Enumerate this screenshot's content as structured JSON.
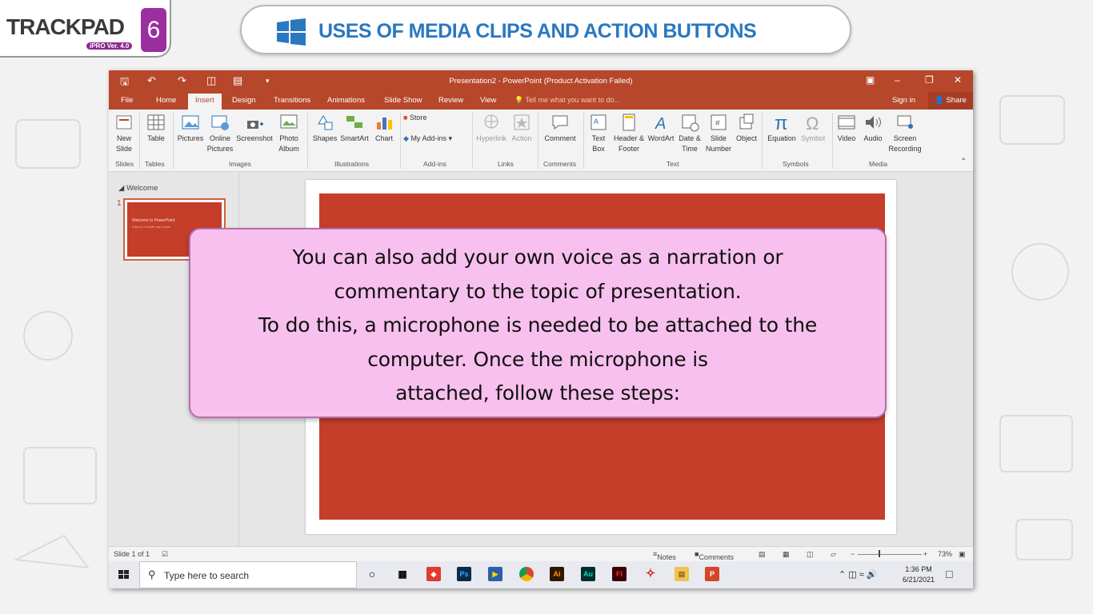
{
  "logo": {
    "text": "TRACKPAD",
    "sub": "iPRO Ver. 4.0",
    "badge": "6"
  },
  "banner": {
    "title": "USES OF MEDIA CLIPS AND ACTION BUTTONS"
  },
  "ppt": {
    "window_title": "Presentation2 - PowerPoint (Product Activation Failed)",
    "tabs": [
      "File",
      "Home",
      "Insert",
      "Design",
      "Transitions",
      "Animations",
      "Slide Show",
      "Review",
      "View"
    ],
    "active_tab": "Insert",
    "tell_me": "Tell me what you want to do...",
    "sign_in": "Sign in",
    "share": "Share",
    "ribbon": {
      "new_slide": "New Slide",
      "table": "Table",
      "pictures": "Pictures",
      "online_pictures": "Online Pictures",
      "screenshot": "Screenshot",
      "photo_album": "Photo Album",
      "shapes": "Shapes",
      "smartart": "SmartArt",
      "chart": "Chart",
      "store": "Store",
      "my_addins": "My Add-ins",
      "hyperlink": "Hyperlink",
      "action": "Action",
      "comment": "Comment",
      "text_box": "Text Box",
      "header_footer": "Header & Footer",
      "wordart": "WordArt",
      "date_time": "Date & Time",
      "slide_number": "Slide Number",
      "object": "Object",
      "equation": "Equation",
      "symbol": "Symbol",
      "video": "Video",
      "audio": "Audio",
      "screen_recording": "Screen Recording",
      "groups": [
        "Slides",
        "Tables",
        "Images",
        "Illustrations",
        "Add-ins",
        "Links",
        "Comments",
        "Text",
        "Symbols",
        "Media"
      ]
    },
    "thumbs": {
      "section": "Welcome",
      "slide_number": "1",
      "slide_title": "Welcome to PowerPoint",
      "slide_subtitle": "5 tips for a simpler way to work"
    },
    "status": {
      "slide_info": "Slide 1 of 1",
      "notes": "Notes",
      "comments": "Comments",
      "zoom": "73%"
    },
    "taskbar": {
      "search_placeholder": "Type here to search",
      "time": "1:36 PM",
      "date": "6/21/2021"
    }
  },
  "callout": {
    "lines": [
      "You can also add your own voice as a narration or",
      "commentary to the topic of presentation.",
      "To do this, a microphone is needed to be attached to the",
      "computer. Once the microphone is",
      "attached, follow these steps:"
    ]
  }
}
